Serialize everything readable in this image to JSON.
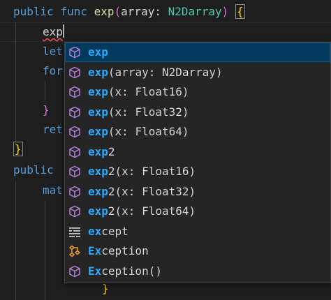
{
  "colors": {
    "keyword": "#569cd6",
    "function": "#dcdcaa",
    "type": "#4ec9b0",
    "bracket": "#ffd700",
    "match_highlight": "#2aaaff",
    "method_icon": "#b180d7",
    "class_icon": "#ee9d28",
    "selected_row": "#04395e"
  },
  "code": {
    "line1": {
      "kw1": "public",
      "kw2": "func",
      "name": "exp",
      "open_paren": "(",
      "param": "array:",
      "type": "N2Darray",
      "close_paren": ")",
      "brace": "{"
    },
    "line2_typed": "exp",
    "line3": "let",
    "line4": "for",
    "line6": "}",
    "line7": "ret",
    "line8": "}",
    "line9": "public",
    "line10": "mat",
    "line14": "}"
  },
  "suggestions": [
    {
      "pre": "",
      "match": "exp",
      "post": "",
      "icon": "method-icon"
    },
    {
      "pre": "",
      "match": "exp",
      "post": "(array: N2Darray)",
      "icon": "method-icon"
    },
    {
      "pre": "",
      "match": "exp",
      "post": "(x: Float16)",
      "icon": "method-icon"
    },
    {
      "pre": "",
      "match": "exp",
      "post": "(x: Float32)",
      "icon": "method-icon"
    },
    {
      "pre": "",
      "match": "exp",
      "post": "(x: Float64)",
      "icon": "method-icon"
    },
    {
      "pre": "",
      "match": "exp",
      "post": "2",
      "icon": "method-icon"
    },
    {
      "pre": "",
      "match": "exp",
      "post": "2(x: Float16)",
      "icon": "method-icon"
    },
    {
      "pre": "",
      "match": "exp",
      "post": "2(x: Float32)",
      "icon": "method-icon"
    },
    {
      "pre": "",
      "match": "exp",
      "post": "2(x: Float64)",
      "icon": "method-icon"
    },
    {
      "pre": "",
      "match": "ex",
      "post": "cept",
      "mid": "",
      "icon": "keyword-icon"
    },
    {
      "pre": "",
      "match": "Ex",
      "post": "ception",
      "icon": "class-icon"
    },
    {
      "pre": "",
      "match": "Ex",
      "post": "ception()",
      "icon": "method-icon"
    }
  ]
}
